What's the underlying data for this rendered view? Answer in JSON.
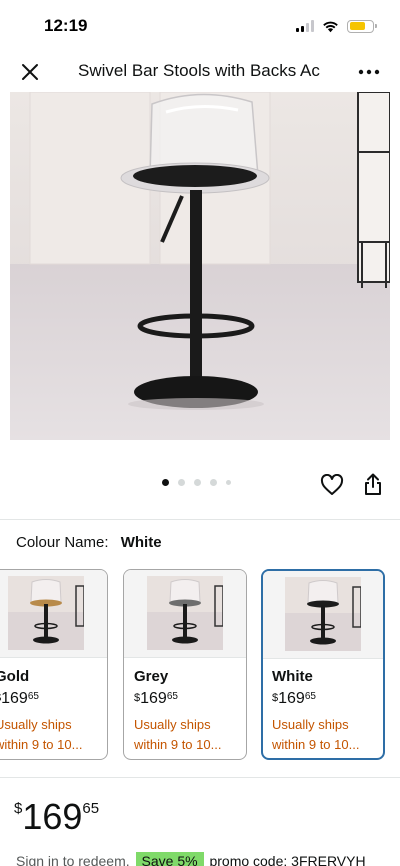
{
  "status_bar": {
    "time": "12:19",
    "battery_level": 0.72
  },
  "nav": {
    "title": "Swivel Bar Stools with Backs Ac",
    "close_icon": "close-icon",
    "more_icon": "more-icon"
  },
  "gallery": {
    "dot_count": 5,
    "active_index": 0
  },
  "colour": {
    "label": "Colour Name:",
    "selected": "White"
  },
  "swatches": [
    {
      "name": "Gold",
      "currency": "$",
      "whole": "169",
      "fraction": "65",
      "ship_line1": "Usually ships",
      "ship_line2": "within 9 to 10..."
    },
    {
      "name": "Grey",
      "currency": "$",
      "whole": "169",
      "fraction": "65",
      "ship_line1": "Usually ships",
      "ship_line2": "within 9 to 10..."
    },
    {
      "name": "White",
      "currency": "$",
      "whole": "169",
      "fraction": "65",
      "ship_line1": "Usually ships",
      "ship_line2": "within 9 to 10..."
    }
  ],
  "price": {
    "currency": "$",
    "whole": "169",
    "fraction": "65"
  },
  "promo": {
    "prefix": "Sign in to redeem.",
    "badge": "Save 5%",
    "text": "promo code: 3FRERVYH"
  },
  "colors": {
    "accent_blue": "#2e6ea6",
    "shipping_orange": "#c45500",
    "promo_green": "#7fda69"
  }
}
